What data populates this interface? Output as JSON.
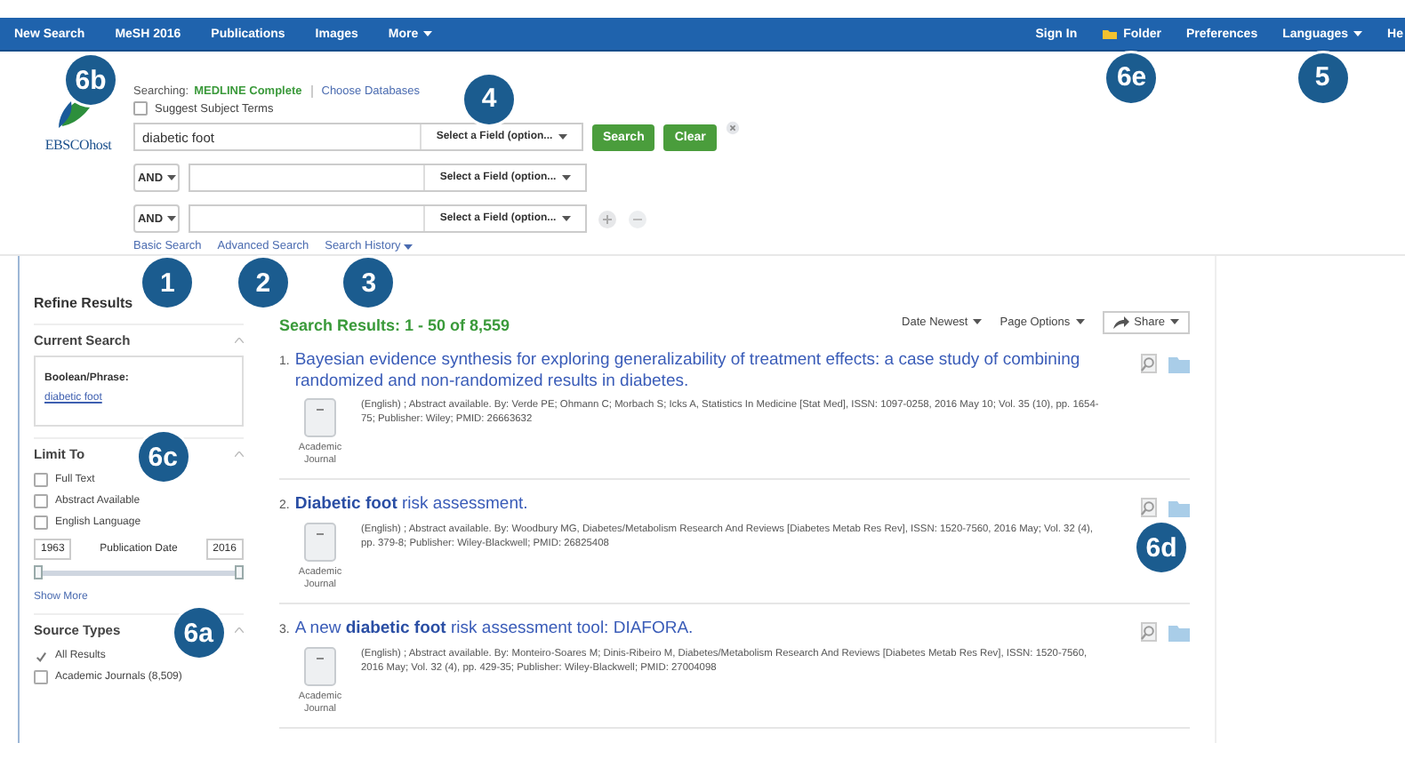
{
  "nav": {
    "left": [
      {
        "label": "New Search",
        "kind": "link"
      },
      {
        "label": "MeSH 2016",
        "kind": "link"
      },
      {
        "label": "Publications",
        "kind": "link"
      },
      {
        "label": "Images",
        "kind": "link"
      },
      {
        "label": "More",
        "kind": "menu"
      }
    ],
    "right": [
      {
        "label": "Sign In",
        "kind": "link"
      },
      {
        "label": "Folder",
        "kind": "folder",
        "callout": "6e"
      },
      {
        "label": "Preferences",
        "kind": "link"
      },
      {
        "label": "Languages",
        "kind": "menu",
        "callout": "5"
      },
      {
        "label": "He",
        "kind": "link"
      }
    ]
  },
  "logo": {
    "text": "EBSCOhost",
    "callout": "6b"
  },
  "search": {
    "searching_label": "Searching:",
    "database": "MEDLINE Complete",
    "choose": "Choose Databases",
    "callout": "4",
    "suggest": {
      "label": "Suggest Subject Terms",
      "checked": false
    },
    "rows": [
      {
        "kind": "first",
        "value": "diabetic foot",
        "field": "Select a Field (option..."
      },
      {
        "kind": "more",
        "operator": "AND",
        "field": "Select a Field (option..."
      },
      {
        "kind": "last",
        "operator": "AND",
        "field": "Select a Field (option..."
      }
    ],
    "search_button": "Search",
    "clear_button": "Clear",
    "links": [
      {
        "label": "Basic Search",
        "callout": "1"
      },
      {
        "label": "Advanced Search",
        "callout": "2"
      },
      {
        "label": "Search History",
        "kind": "menu",
        "callout": "3"
      }
    ]
  },
  "sidebar": {
    "title": "Refine Results",
    "current": {
      "title": "Current Search",
      "label": "Boolean/Phrase:",
      "term": "diabetic foot"
    },
    "limit": {
      "title": "Limit To",
      "callout": "6c",
      "options": [
        {
          "label": "Full Text",
          "checked": false
        },
        {
          "label": "Abstract Available",
          "checked": false
        },
        {
          "label": "English Language",
          "checked": false
        }
      ],
      "date_from": "1963",
      "date_label": "Publication Date",
      "date_to": "2016",
      "date_range": {
        "level": 1
      },
      "show_more": "Show More"
    },
    "sources": {
      "title": "Source Types",
      "callout": "6a",
      "options": [
        {
          "label": "All Results",
          "checked": true
        },
        {
          "label": "Academic Journals (8,509)",
          "checked": false
        }
      ]
    }
  },
  "results": {
    "summary": "Search Results: 1 - 50 of 8,559",
    "sort": "Date Newest",
    "page_options": "Page Options",
    "share": "Share",
    "items": [
      {
        "number": "1.",
        "title": "Bayesian evidence synthesis for exploring generalizability of treatment effects: a case study of combining randomized and non-randomized results in diabetes.",
        "citation": "(English) ; Abstract available. By: Verde PE; Ohmann C; Morbach S; Icks A, Statistics In Medicine [Stat Med], ISSN: 1097-0258, 2016 May 10; Vol. 35 (10), pp. 1654-75; Publisher: Wiley; PMID: 26663632",
        "type": "Academic Journal"
      },
      {
        "number": "2.",
        "title": "**Diabetic foot** risk assessment.",
        "citation": "(English) ; Abstract available. By: Woodbury MG, Diabetes/Metabolism Research And Reviews [Diabetes Metab Res Rev], ISSN: 1520-7560, 2016 May; Vol. 32 (4), pp. 379-8; Publisher: Wiley-Blackwell; PMID: 26825408",
        "type": "Academic Journal",
        "callout": "6d"
      },
      {
        "number": "3.",
        "title": "A new **diabetic foot** risk assessment tool: DIAFORA.",
        "citation": "(English) ; Abstract available. By: Monteiro-Soares M; Dinis-Ribeiro M, Diabetes/Metabolism Research And Reviews [Diabetes Metab Res Rev], ISSN: 1520-7560, 2016 May; Vol. 32 (4), pp. 429-35; Publisher: Wiley-Blackwell; PMID: 27004098",
        "type": "Academic Journal"
      }
    ]
  }
}
